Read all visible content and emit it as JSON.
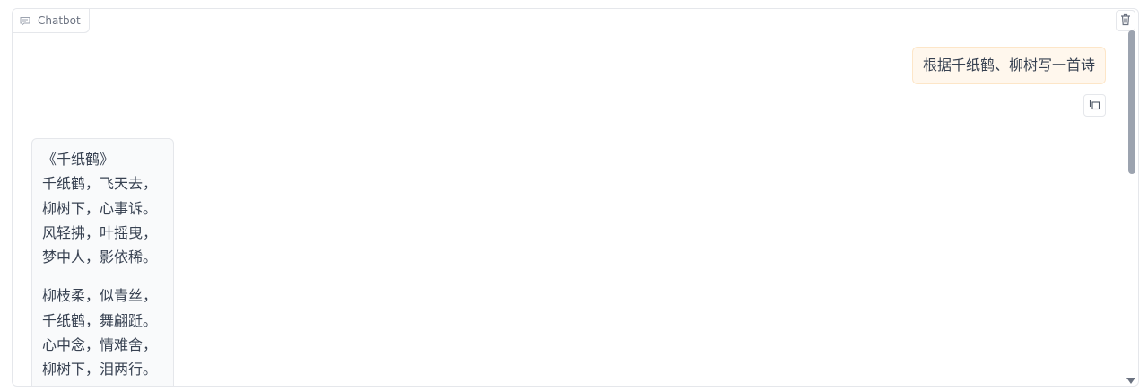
{
  "chatbot": {
    "label": "Chatbot",
    "icons": {
      "label": "chat-bubble-icon",
      "clear": "trash-icon",
      "copy": "copy-icon"
    }
  },
  "messages": [
    {
      "role": "user",
      "text": "根据千纸鹤、柳树写一首诗"
    },
    {
      "role": "bot",
      "stanzas": [
        [
          "《千纸鹤》",
          "千纸鹤，飞天去，",
          "柳树下，心事诉。",
          "风轻拂，叶摇曳，",
          "梦中人，影依稀。"
        ],
        [
          "柳枝柔，似青丝，",
          "千纸鹤，舞翩跹。",
          "心中念，情难舍，",
          "柳树下，泪两行。"
        ]
      ]
    }
  ]
}
